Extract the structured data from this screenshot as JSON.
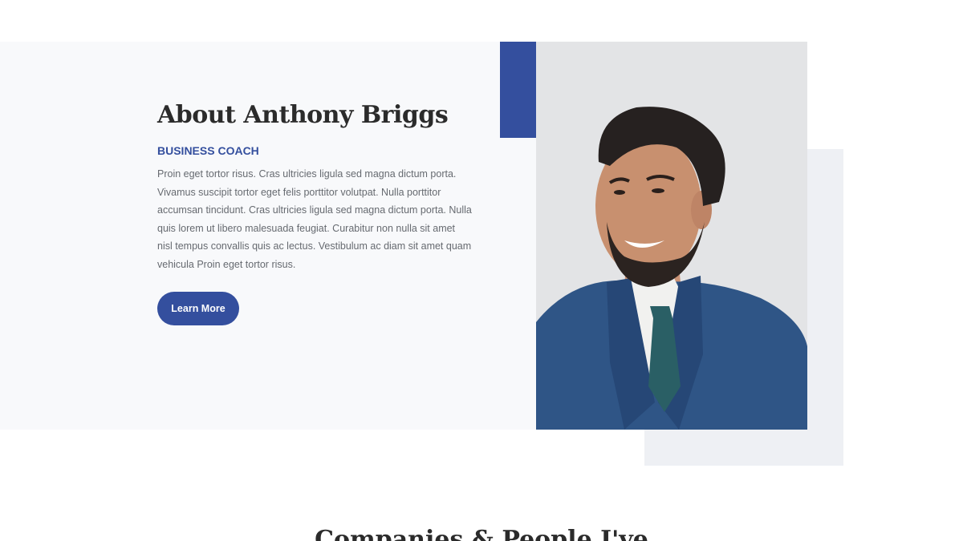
{
  "about": {
    "heading": "About Anthony Briggs",
    "subheading": "BUSINESS COACH",
    "bio": "Proin eget tortor risus. Cras ultricies ligula sed magna dictum porta. Vivamus suscipit tortor eget felis porttitor volutpat. Nulla porttitor accumsan tincidunt. Cras ultricies ligula sed magna dictum porta. Nulla quis lorem ut libero malesuada feugiat. Curabitur non nulla sit amet nisl tempus convallis quis ac lectus. Vestibulum ac diam sit amet quam vehicula Proin eget tortor risus.",
    "button_label": "Learn More"
  },
  "next_section": {
    "heading": "Companies & People I've"
  },
  "colors": {
    "accent": "#344f9e",
    "heading": "#2b2b2b",
    "body_text": "#666a70",
    "panel": "#f8f9fb"
  }
}
